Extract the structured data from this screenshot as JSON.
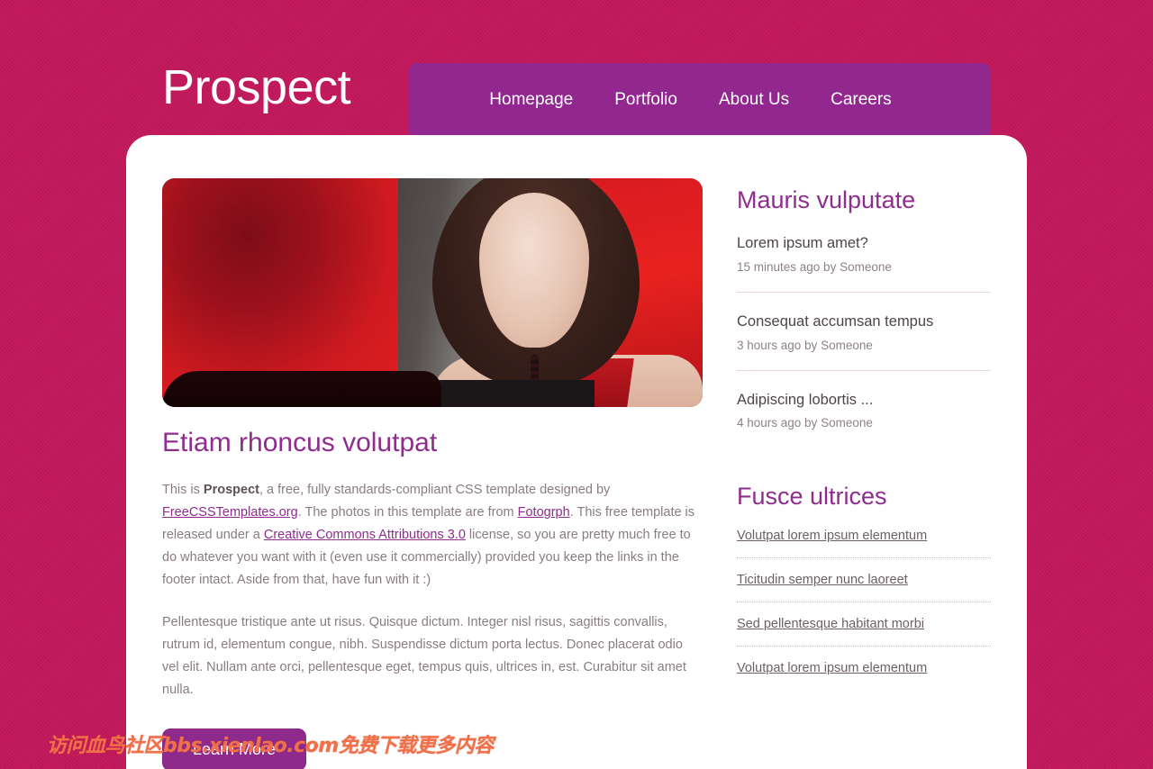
{
  "header": {
    "site_title": "Prospect",
    "nav_items": [
      {
        "label": "Homepage"
      },
      {
        "label": "Portfolio"
      },
      {
        "label": "About Us"
      },
      {
        "label": "Careers"
      }
    ]
  },
  "main": {
    "article_title": "Etiam rhoncus volutpat",
    "paragraph1": {
      "part1": "This is ",
      "bold": "Prospect",
      "part2": ", a free, fully standards-compliant CSS template designed by ",
      "link1": "FreeCSSTemplates.org",
      "part3": ". The photos in this template are from ",
      "link2": "Fotogrph",
      "part4": ". This free template is released under a ",
      "link3": "Creative Commons Attributions 3.0",
      "part5": " license, so you are pretty much free to do whatever you want with it (even use it commercially) provided you keep the links in the footer intact. Aside from that, have fun with it :)"
    },
    "paragraph2": "Pellentesque tristique ante ut risus. Quisque dictum. Integer nisl risus, sagittis convallis, rutrum id, elementum congue, nibh. Suspendisse dictum porta lectus. Donec placerat odio vel elit. Nullam ante orci, pellentesque eget, tempus quis, ultrices in, est. Curabitur sit amet nulla.",
    "learn_more_label": "Learn More"
  },
  "sidebar": {
    "posts_heading": "Mauris vulputate",
    "posts": [
      {
        "title": "Lorem ipsum amet?",
        "meta": "15 minutes ago by Someone"
      },
      {
        "title": "Consequat accumsan tempus",
        "meta": "3 hours ago by Someone"
      },
      {
        "title": "Adipiscing lobortis ...",
        "meta": "4 hours ago by Someone"
      }
    ],
    "links_heading": "Fusce ultrices",
    "links": [
      {
        "label": "Volutpat lorem ipsum elementum"
      },
      {
        "label": "Ticitudin semper nunc laoreet"
      },
      {
        "label": "Sed pellentesque habitant morbi"
      },
      {
        "label": "Volutpat lorem ipsum elementum"
      }
    ]
  },
  "watermark": {
    "text": "访问血鸟社区bbs.xienlao.com免费下载更多内容"
  },
  "colors": {
    "page_background": "#c2185b",
    "nav_background": "#91278f",
    "heading_purple": "#8e2d8e",
    "button_purple": "#8e2a8b",
    "body_text": "#8a7c80",
    "card_white": "#ffffff",
    "watermark_orange": "#f0704a"
  }
}
